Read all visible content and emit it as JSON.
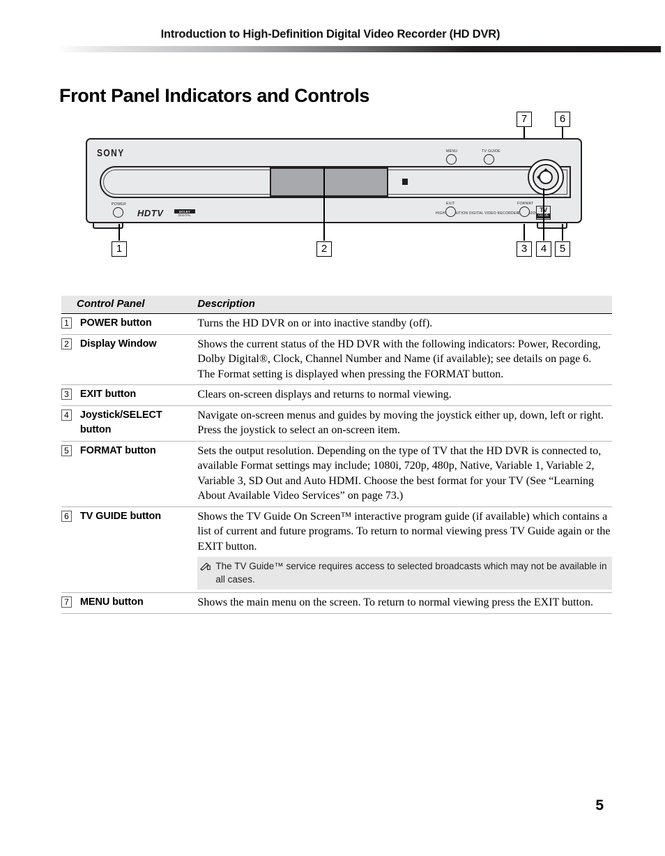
{
  "header": {
    "running_head": "Introduction to High-Definition Digital Video Recorder (HD DVR)"
  },
  "section": {
    "title": "Front Panel Indicators and Controls"
  },
  "figure": {
    "brand": "SONY",
    "power_label": "POWER",
    "menu_label": "MENU",
    "tvguide_label": "TV GUIDE",
    "exit_label": "EXIT",
    "format_label": "FORMAT",
    "hdtv_logo": "HDTV",
    "dolby_line1": "DOLBY",
    "dolby_line2": "DIGITAL",
    "model_text": "HIGH-DEFINITION DIGITAL VIDEO RECORDER",
    "model_number": "DHG-HDD500",
    "tvguide_badge_top": "TV",
    "tvguide_badge_bottom": "GUIDE",
    "callouts": [
      {
        "id": "callout-7",
        "number": "7"
      },
      {
        "id": "callout-6",
        "number": "6"
      },
      {
        "id": "callout-1",
        "number": "1"
      },
      {
        "id": "callout-2",
        "number": "2"
      },
      {
        "id": "callout-3",
        "number": "3"
      },
      {
        "id": "callout-4",
        "number": "4"
      },
      {
        "id": "callout-5",
        "number": "5"
      }
    ]
  },
  "table": {
    "columns": {
      "control_panel": "Control Panel",
      "description": "Description"
    },
    "rows": [
      {
        "number": "1",
        "name": "POWER button",
        "name_line2": "",
        "paragraphs": [
          "Turns the HD DVR on or into inactive standby (off)."
        ]
      },
      {
        "number": "2",
        "name": "Display Window",
        "name_line2": "",
        "paragraphs": [
          "Shows the current status of the HD DVR with the following indicators: Power, Recording, Dolby Digital®, Clock, Channel Number and Name (if available); see details on page 6.",
          "The Format setting is displayed when pressing the FORMAT button."
        ]
      },
      {
        "number": "3",
        "name": "EXIT button",
        "name_line2": "",
        "paragraphs": [
          " Clears on-screen displays and returns to normal viewing."
        ]
      },
      {
        "number": "4",
        "name": "Joystick/SELECT",
        "name_line2": "button",
        "paragraphs": [
          "Navigate on-screen menus and guides by moving the joystick either up, down, left or right. Press the joystick to select an on-screen item."
        ]
      },
      {
        "number": "5",
        "name": "FORMAT button",
        "name_line2": "",
        "paragraphs": [
          "Sets the output resolution.  Depending on the type of TV that the HD DVR is connected to, available Format settings may include; 1080i, 720p, 480p, Native, Variable 1, Variable 2, Variable 3, SD Out and Auto HDMI.  Choose the best format for your TV (See “Learning About Available Video Services” on page 73.)"
        ]
      },
      {
        "number": "6",
        "name": "TV GUIDE button",
        "name_line2": "",
        "paragraphs": [
          "Shows the TV Guide On Screen™ interactive program guide (if available) which contains a list of current and future programs. To return to normal viewing press TV Guide again or the EXIT button."
        ],
        "note": "The TV Guide™ service requires access to selected broadcasts which may not be available in all cases."
      },
      {
        "number": "7",
        "name": "MENU button",
        "name_line2": "",
        "paragraphs": [
          "Shows the main menu on the screen. To return to normal viewing press the EXIT button."
        ]
      }
    ]
  },
  "footer": {
    "page_number": "5"
  }
}
